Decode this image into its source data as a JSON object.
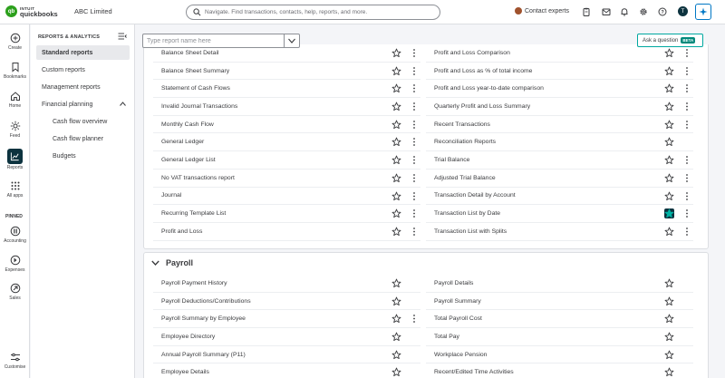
{
  "topbar": {
    "logo_intuit": "INTUIT",
    "logo_qb": "quickbooks",
    "company": "ABC Limited",
    "search_placeholder": "Navigate. Find transactions, contacts, help, reports, and more.",
    "contact_experts": "Contact experts",
    "avatar_letter": "T"
  },
  "rail": {
    "items": [
      {
        "label": "Create",
        "icon": "plus-circle-icon"
      },
      {
        "label": "Bookmarks",
        "icon": "bookmark-icon"
      },
      {
        "label": "Home",
        "icon": "home-icon"
      },
      {
        "label": "Feed",
        "icon": "feed-icon"
      },
      {
        "label": "Reports",
        "icon": "reports-icon"
      },
      {
        "label": "All apps",
        "icon": "grid-icon"
      }
    ],
    "pinned_label": "PINNED",
    "pinned": [
      {
        "label": "Accounting",
        "icon": "accounting-icon"
      },
      {
        "label": "Expenses",
        "icon": "expenses-icon"
      },
      {
        "label": "Sales",
        "icon": "sales-icon"
      }
    ],
    "customise": "Customise"
  },
  "submenu": {
    "heading": "REPORTS & ANALYTICS",
    "items": [
      {
        "label": "Standard reports",
        "active": true
      },
      {
        "label": "Custom reports"
      },
      {
        "label": "Management reports"
      },
      {
        "label": "Financial planning"
      },
      {
        "label": "Cash flow overview"
      },
      {
        "label": "Cash flow planner"
      },
      {
        "label": "Budgets"
      }
    ]
  },
  "main": {
    "report_search_placeholder": "Type report name here",
    "ask_question": "Ask a question",
    "beta": "BETA",
    "section1": {
      "left": [
        {
          "label": "Balance Sheet Detail",
          "kebab": true
        },
        {
          "label": "Balance Sheet Summary",
          "kebab": true
        },
        {
          "label": "Statement of Cash Flows",
          "kebab": true
        },
        {
          "label": "Invalid Journal Transactions",
          "kebab": true
        },
        {
          "label": "Monthly Cash Flow",
          "kebab": true
        },
        {
          "label": "General Ledger",
          "kebab": true
        },
        {
          "label": "General Ledger List",
          "kebab": true
        },
        {
          "label": "No VAT transactions report",
          "kebab": true
        },
        {
          "label": "Journal",
          "kebab": true
        },
        {
          "label": "Recurring Template List",
          "kebab": true
        },
        {
          "label": "Profit and Loss",
          "kebab": true
        }
      ],
      "right": [
        {
          "label": "Profit and Loss Comparison",
          "kebab": true
        },
        {
          "label": "Profit and Loss as % of total income",
          "kebab": true
        },
        {
          "label": "Profit and Loss year-to-date comparison",
          "kebab": true
        },
        {
          "label": "Quarterly Profit and Loss Summary",
          "kebab": true
        },
        {
          "label": "Recent Transactions",
          "kebab": true
        },
        {
          "label": "Reconciliation Reports",
          "kebab": false
        },
        {
          "label": "Trial Balance",
          "kebab": true
        },
        {
          "label": "Adjusted Trial Balance",
          "kebab": true
        },
        {
          "label": "Transaction Detail by Account",
          "kebab": true
        },
        {
          "label": "Transaction List by Date",
          "kebab": true,
          "favorite": true
        },
        {
          "label": "Transaction List with Splits",
          "kebab": true
        }
      ]
    },
    "section2": {
      "title": "Payroll",
      "left": [
        {
          "label": "Payroll Payment History",
          "kebab": false
        },
        {
          "label": "Payroll Deductions/Contributions",
          "kebab": false
        },
        {
          "label": "Payroll Summary by Employee",
          "kebab": true
        },
        {
          "label": "Employee Directory",
          "kebab": false
        },
        {
          "label": "Annual Payroll Summary (P11)",
          "kebab": false
        },
        {
          "label": "Employee Details",
          "kebab": false
        }
      ],
      "right": [
        {
          "label": "Payroll Details",
          "kebab": false
        },
        {
          "label": "Payroll Summary",
          "kebab": false
        },
        {
          "label": "Total Payroll Cost",
          "kebab": false
        },
        {
          "label": "Total Pay",
          "kebab": false
        },
        {
          "label": "Workplace Pension",
          "kebab": false
        },
        {
          "label": "Recent/Edited Time Activities",
          "kebab": false
        }
      ]
    }
  }
}
